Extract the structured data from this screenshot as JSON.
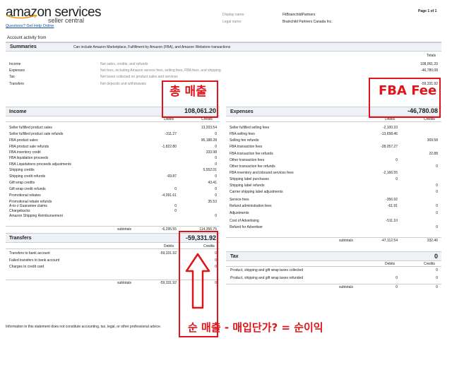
{
  "header": {
    "logo_main": "amazon services",
    "logo_sub": "seller central",
    "help_link": "Questions? Get Help Online",
    "display_name_label": "Display name:",
    "display_name_value": "FitBrainchildPartners",
    "legal_name_label": "Legal name:",
    "legal_name_value": "Brainchild Partners Canada Inc.",
    "page_indicator": "Page 1 of 1"
  },
  "account_activity": "Account activity from",
  "summaries": {
    "title": "Summaries",
    "description": "Can include Amazon Marketplace, Fulfillment by Amazon (FBA), and Amazon Webstore transactions",
    "totals_header": "Totals",
    "rows": [
      {
        "label": "Income",
        "desc": "Net sales, credits, and refunds",
        "total": "108,061.20"
      },
      {
        "label": "Expenses",
        "desc": "Net fees, including Amazon service fees, selling fees, FBA fees, and shipping",
        "total": "-46,780.08"
      },
      {
        "label": "Tax",
        "desc": "Net taxes collected on product sales and services",
        "total": ""
      },
      {
        "label": "Transfers",
        "desc": "Net deposits and withdrawals",
        "total": "-59,331.92"
      }
    ]
  },
  "income": {
    "title": "Income",
    "total": "108,061.20",
    "debits_header": "Debits",
    "credits_header": "Credits",
    "rows": [
      {
        "label": "Seller fulfilled product sales",
        "debit": "",
        "credit": "13,203.54"
      },
      {
        "label": "Seller fulfilled product sale refunds",
        "debit": "-311.27",
        "credit": "0"
      },
      {
        "label": "FBA product sales",
        "debit": "",
        "credit": "95,188.28"
      },
      {
        "label": "FBA product sale refunds",
        "debit": "-1,822.80",
        "credit": "0"
      },
      {
        "label": "FBA inventory credit",
        "debit": "",
        "credit": "333.98"
      },
      {
        "label": "FBA liquidation proceeds",
        "debit": "",
        "credit": "0"
      },
      {
        "label": "FBA Liquidations proceeds adjustments",
        "debit": "",
        "credit": "0"
      },
      {
        "label": "Shipping credits",
        "debit": "",
        "credit": "5,552.01"
      },
      {
        "label": "Shipping credit refunds",
        "debit": "-69.87",
        "credit": "0"
      },
      {
        "label": "Gift wrap credits",
        "debit": "",
        "credit": "43.41"
      },
      {
        "label": "Gift wrap credit refunds",
        "debit": "0",
        "credit": "0"
      },
      {
        "label": "Promotional rebates",
        "debit": "-4,091.61",
        "credit": "0"
      },
      {
        "label": "Promotional rebate refunds",
        "debit": "",
        "credit": "35.53"
      },
      {
        "label": "A-to-z Guarantee claims",
        "debit": "0",
        "credit": ""
      },
      {
        "label": "Chargebacks",
        "debit": "0",
        "credit": ""
      },
      {
        "label": "Amazon Shipping Reimbursement",
        "debit": "",
        "credit": "0"
      }
    ],
    "subtotals_label": "subtotals",
    "subtotal_debit": "-6,295.55",
    "subtotal_credit": "114,356.75"
  },
  "transfers": {
    "title": "Transfers",
    "total": "-59,331.92",
    "debits_header": "Debits",
    "rows": [
      {
        "label": "Transfers to bank account",
        "debit": "-59,331.92",
        "credit": "0"
      },
      {
        "label": "Failed transfers to bank account",
        "debit": "",
        "credit": "0"
      },
      {
        "label": "Charges to credit card",
        "debit": "",
        "credit": "0"
      }
    ],
    "subtotals_label": "subtotals",
    "subtotal_debit": "-59,331.92",
    "subtotal_credit": "0"
  },
  "expenses": {
    "title": "Expenses",
    "total": "-46,780.08",
    "debits_header": "Debits",
    "credits_header": "Credits",
    "rows": [
      {
        "label": "Seller fulfilled selling fees",
        "debit": "-2,100.33",
        "credit": ""
      },
      {
        "label": "FBA selling fees",
        "debit": "-13,658.46",
        "credit": ""
      },
      {
        "label": "Selling fee refunds",
        "debit": "",
        "credit": "309.58"
      },
      {
        "label": "FBA transaction fees",
        "debit": "-28,057.27",
        "credit": ""
      },
      {
        "label": "FBA transaction fee refunds",
        "debit": "",
        "credit": "22.88"
      },
      {
        "label": "Other transaction fees",
        "debit": "0",
        "credit": ""
      },
      {
        "label": "Other transaction fee refunds",
        "debit": "",
        "credit": "0"
      },
      {
        "label": "FBA inventory and inbound services fees",
        "debit": "-2,166.55",
        "credit": ""
      },
      {
        "label": "Shipping label purchases",
        "debit": "0",
        "credit": ""
      },
      {
        "label": "Shipping label refunds",
        "debit": "",
        "credit": "0"
      },
      {
        "label": "Carrier shipping label adjustments",
        "debit": "",
        "credit": "0"
      },
      {
        "label": "Service fees",
        "debit": "-356.92",
        "credit": ""
      },
      {
        "label": "Refund administration fees",
        "debit": "-61.91",
        "credit": "0"
      },
      {
        "label": "Adjustments",
        "debit": "",
        "credit": "0"
      },
      {
        "label": "Cost of Advertising",
        "debit": "-511.10",
        "credit": ""
      },
      {
        "label": "Refund for Advertiser",
        "debit": "",
        "credit": "0"
      }
    ],
    "subtotals_label": "subtotals",
    "subtotal_debit": "-47,112.54",
    "subtotal_credit": "332.46"
  },
  "tax": {
    "title": "Tax",
    "total": "0",
    "debits_header": "Debits",
    "credits_header": "Credits",
    "rows": [
      {
        "label": "Product, shipping and gift wrap taxes collected",
        "debit": "",
        "credit": "0"
      },
      {
        "label": "Product, shipping and gift wrap taxes refunded",
        "debit": "0",
        "credit": "0"
      }
    ],
    "subtotals_label": "subtotals",
    "subtotal_debit": "0",
    "subtotal_credit": "0"
  },
  "disclaimer": "Information in this statement does not constitute accounting, tax, legal, or other professional advice.",
  "annotations": {
    "gross_sales": "총 매출",
    "fba_fee": "FBA Fee",
    "net_formula": "순 매출 - 매입단가? = 순이익",
    "accent_color": "#e0151b"
  }
}
